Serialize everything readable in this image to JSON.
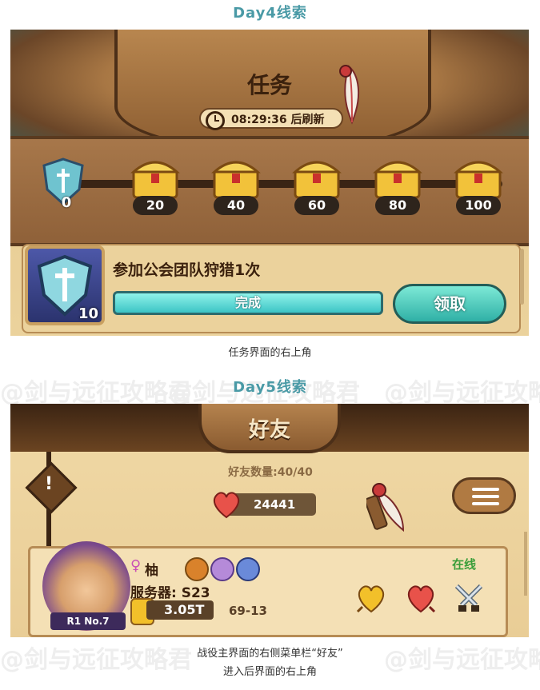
{
  "watermark": "@剑与远征攻略君",
  "day4": {
    "heading": "Day4线索",
    "title": "任务",
    "timer": "08:29:36 后刷新",
    "progress_value": "0",
    "milestones": [
      "20",
      "40",
      "60",
      "80",
      "100"
    ],
    "task": {
      "title": "参加公会团队狩猎1次",
      "level": "10",
      "status": "完成",
      "button": "领取"
    },
    "caption": "任务界面的右上角"
  },
  "day5": {
    "heading": "Day5线索",
    "title": "好友",
    "friend_count": "好友数量:40/40",
    "hearts": "24441",
    "friend": {
      "name": "柚",
      "server": "服务器: S23",
      "power": "3.05T",
      "stage": "69-13",
      "rank": "R1 No.7",
      "status": "在线"
    },
    "caption_lines": [
      "战役主界面的右侧菜单栏“好友”",
      "进入后界面的右上角"
    ]
  },
  "colors": {
    "heading": "#4a9aa6",
    "accent_teal": "#3cc4c5",
    "wood": "#8c5d31"
  }
}
